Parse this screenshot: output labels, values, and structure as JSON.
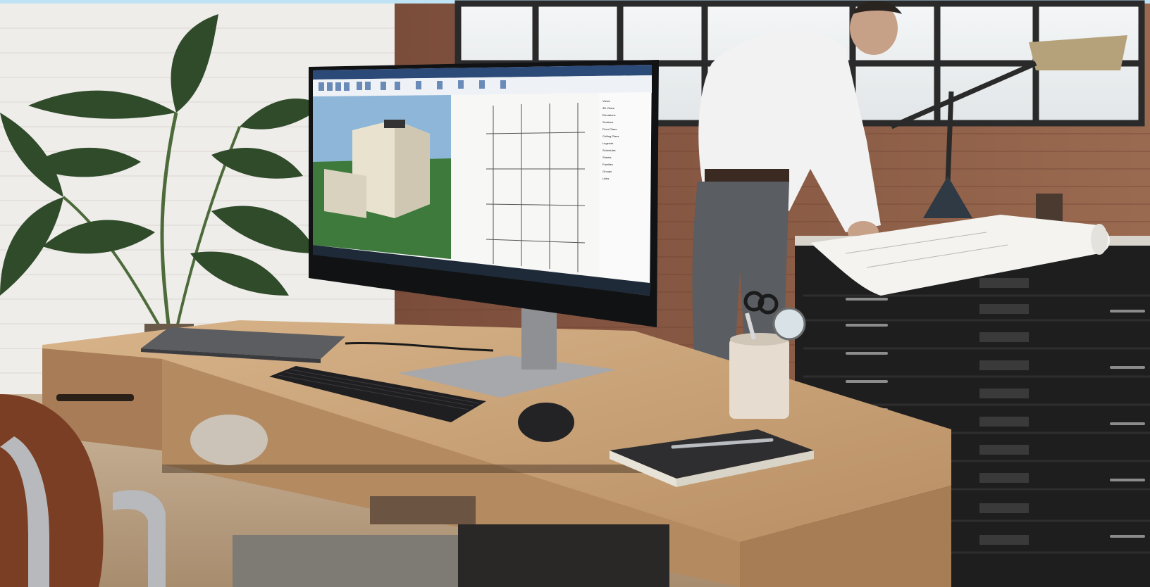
{
  "scene": {
    "kind": "photo",
    "background_colors": {
      "wall": "#f1efeb",
      "brick": "#8a5a45",
      "desk": "#c8a37a",
      "cabinet": "#1e1e1e"
    }
  },
  "monitor": {
    "cad_app": {
      "tree_items": [
        "Views",
        "3D Views",
        "Elevations",
        "Sections",
        "Floor Plans",
        "Ceiling Plans",
        "Legends",
        "Schedules",
        "Sheets",
        "Families",
        "Groups",
        "Links"
      ]
    }
  },
  "cabinet": {
    "drawer_labels": []
  }
}
